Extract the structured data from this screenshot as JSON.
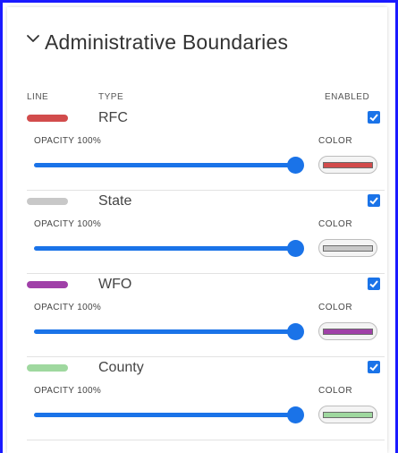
{
  "panel": {
    "title": "Administrative Boundaries",
    "columns": {
      "line": "LINE",
      "type": "TYPE",
      "enabled": "ENABLED"
    },
    "opacity_label": "OPACITY",
    "color_label": "COLOR",
    "rows": [
      {
        "type": "RFC",
        "enabled": true,
        "opacity": "100%",
        "opacity_value": 1.0,
        "color": "#d24c4c"
      },
      {
        "type": "State",
        "enabled": true,
        "opacity": "100%",
        "opacity_value": 1.0,
        "color": "#c8c8c8"
      },
      {
        "type": "WFO",
        "enabled": true,
        "opacity": "100%",
        "opacity_value": 1.0,
        "color": "#a040a8"
      },
      {
        "type": "County",
        "enabled": true,
        "opacity": "100%",
        "opacity_value": 1.0,
        "color": "#9fd89f"
      }
    ]
  },
  "accent_color": "#1a73e8"
}
